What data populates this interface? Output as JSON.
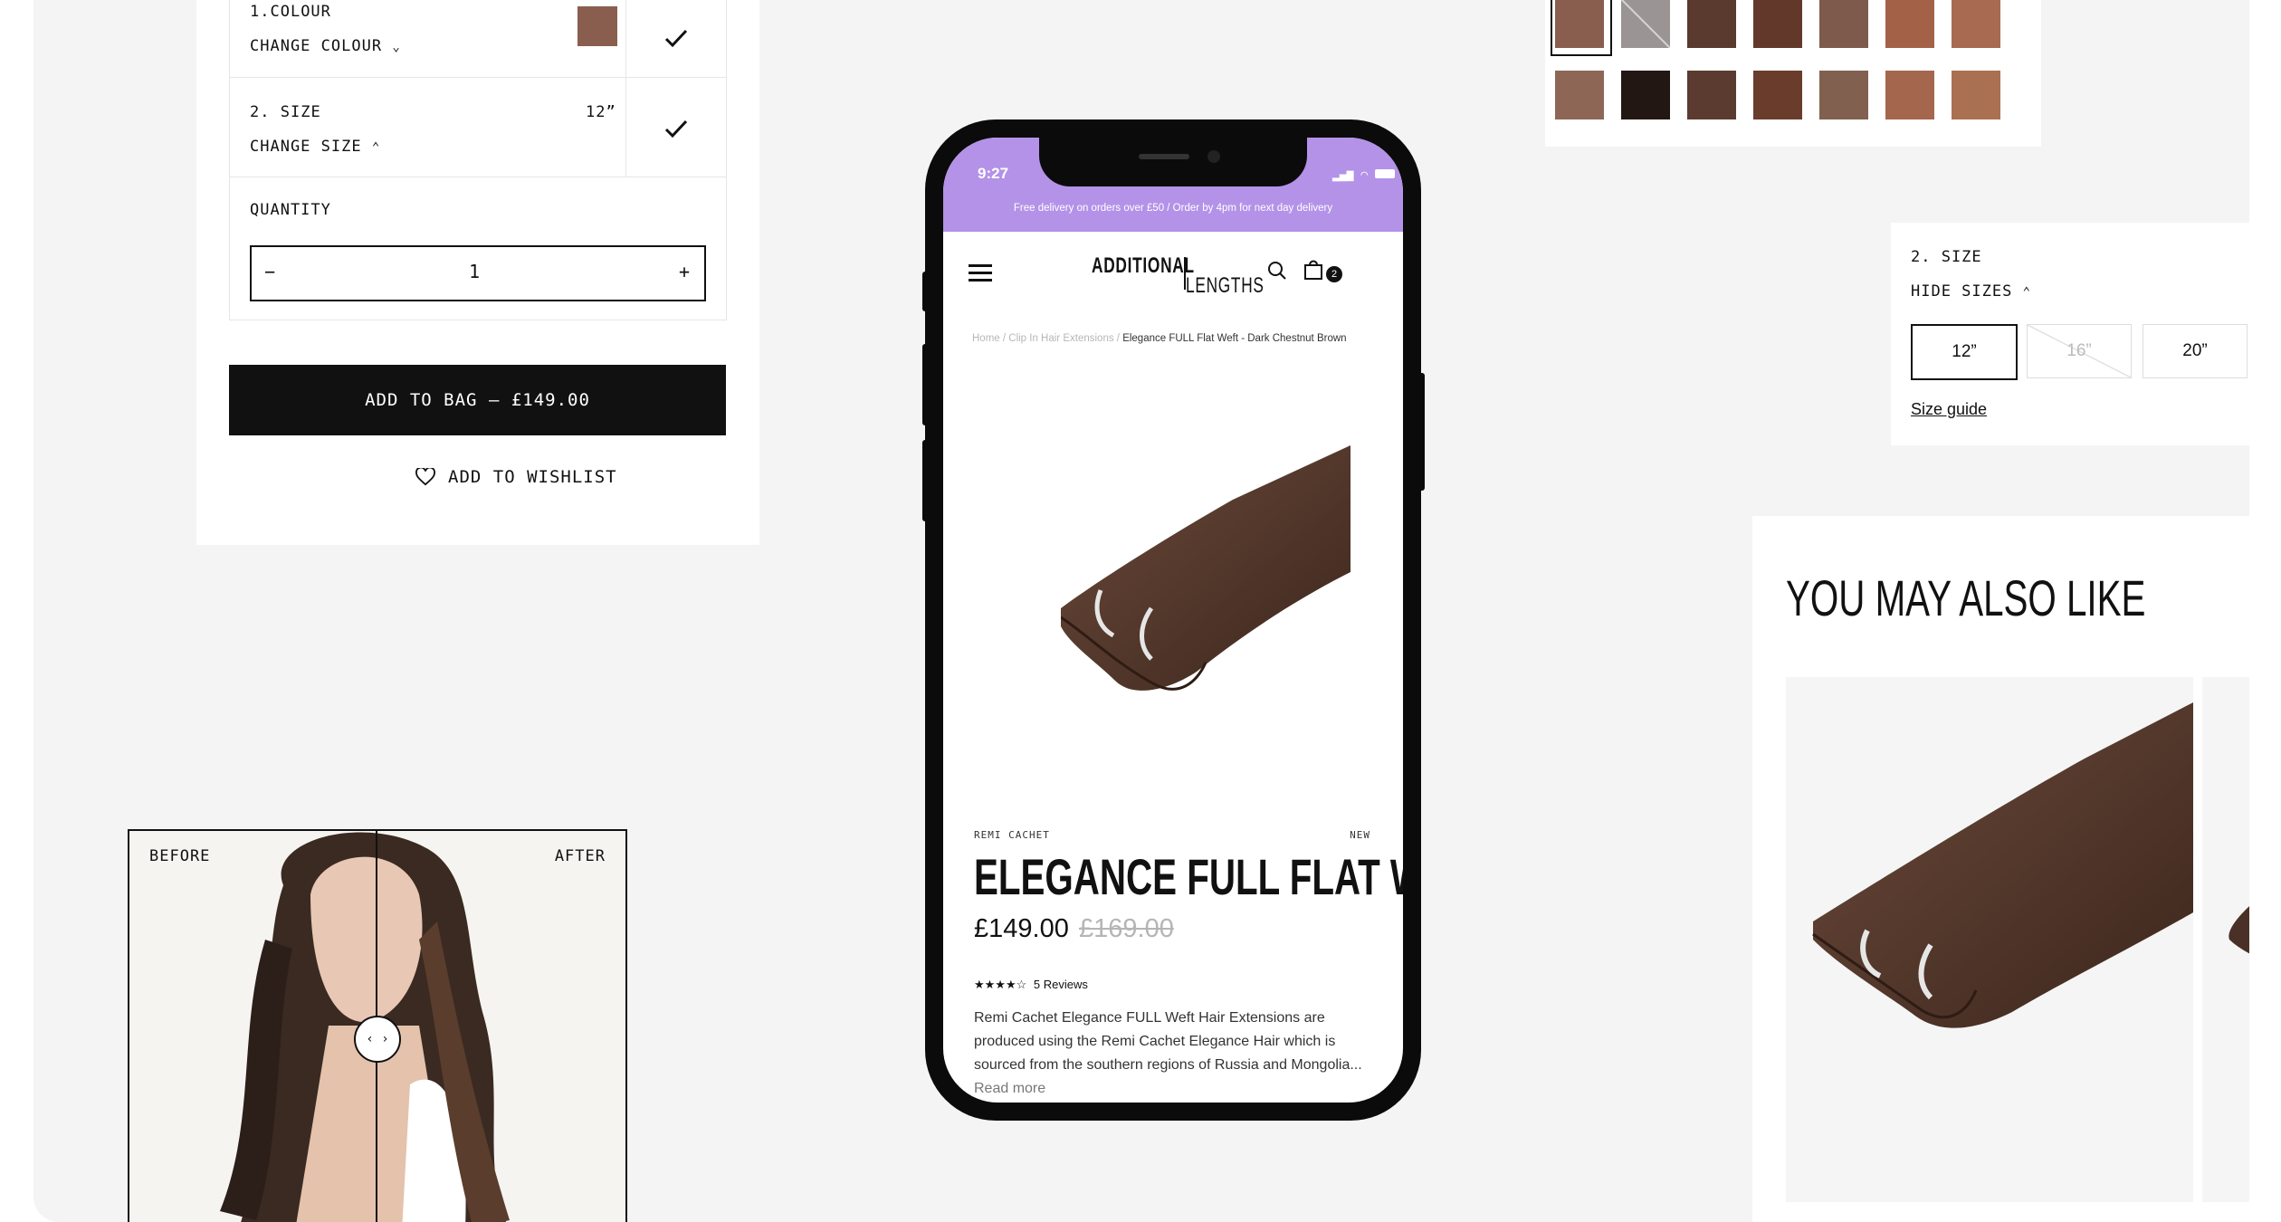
{
  "config": {
    "steps": [
      {
        "number": "1.",
        "title": "COLOUR",
        "action": "CHANGE COLOUR",
        "value": ""
      },
      {
        "number": "2.",
        "title": "SIZE",
        "action": "CHANGE SIZE",
        "value": "12”"
      }
    ],
    "quantity_label": "QUANTITY",
    "quantity_value": "1",
    "minus": "−",
    "plus": "+",
    "add_to_bag": "ADD TO BAG — £149.00",
    "add_to_wishlist": "ADD TO WISHLIST"
  },
  "before_after": {
    "before": "BEFORE",
    "after": "AFTER"
  },
  "phone": {
    "time": "9:27",
    "banner": "Free delivery on orders over £50 / Order by 4pm for next day delivery",
    "logo_top": "ADDITIONAL",
    "logo_bottom": "LENGTHS",
    "cart_count": "2",
    "breadcrumb_links": "Home / Clip In Hair Extensions /",
    "breadcrumb_current": "Elegance FULL Flat Weft - Dark Chestnut Brown",
    "brand": "REMI CACHET",
    "badge": "NEW",
    "title": "ELEGANCE FULL FLAT WEFT",
    "price": "£149.00",
    "old_price": "£169.00",
    "stars": "★★★★☆",
    "reviews": "5 Reviews",
    "description": "Remi Cachet Elegance FULL Weft Hair Extensions are produced using the Remi Cachet Elegance Hair which is sourced from the southern regions of Russia and Mongolia...",
    "read_more": "Read more"
  },
  "size_panel": {
    "step_label": "2. SIZE",
    "hide_sizes": "HIDE SIZES",
    "sizes": [
      "12”",
      "16”",
      "20”"
    ],
    "size_guide": "Size guide"
  },
  "recommendations": {
    "heading": "YOU MAY ALSO LIKE"
  },
  "colors": {
    "canvas_bg": "#f4f4f4",
    "phone_banner": "#b392e8",
    "swatches_row1": [
      "#8a5e4e",
      "#9a9494",
      "#5a3a2e",
      "#62382a",
      "#7e5a4c",
      "#a36248",
      "#a86a50"
    ],
    "swatches_row2": [
      "#8e6656",
      "#231714",
      "#5b3b30",
      "#6a3c2c",
      "#82604f",
      "#a4664c",
      "#aa7052"
    ]
  }
}
